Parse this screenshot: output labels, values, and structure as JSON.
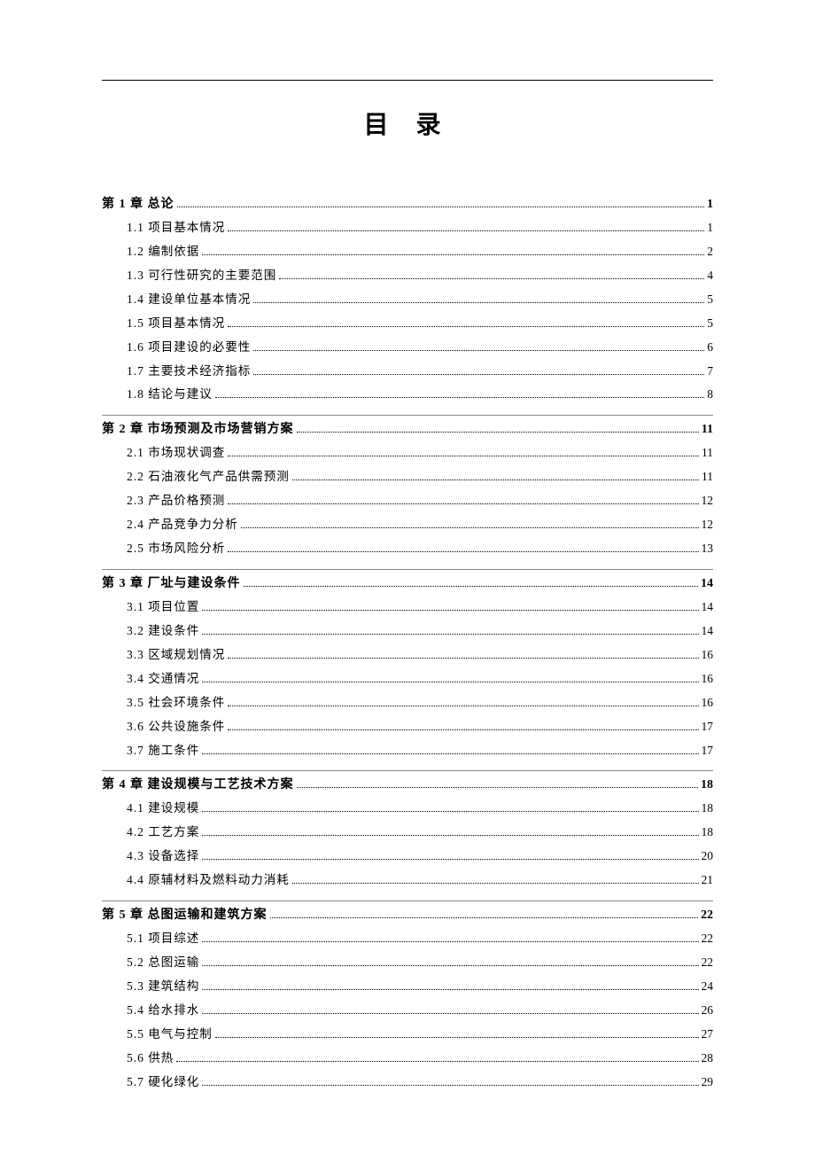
{
  "title": "目 录",
  "toc": [
    {
      "chapter": "第 1 章 总论",
      "page": "1",
      "sections": [
        {
          "num": "1.1",
          "label": "项目基本情况",
          "page": "1"
        },
        {
          "num": "1.2",
          "label": "编制依据",
          "page": "2"
        },
        {
          "num": "1.3",
          "label": "可行性研究的主要范围",
          "page": "4"
        },
        {
          "num": "1.4",
          "label": "建设单位基本情况",
          "page": "5"
        },
        {
          "num": "1.5",
          "label": "项目基本情况",
          "page": "5"
        },
        {
          "num": "1.6",
          "label": "项目建设的必要性",
          "page": "6"
        },
        {
          "num": "1.7",
          "label": "主要技术经济指标",
          "page": "7"
        },
        {
          "num": "1.8",
          "label": "结论与建议",
          "page": "8"
        }
      ]
    },
    {
      "chapter": "第 2 章  市场预测及市场营销方案",
      "page": "11",
      "sections": [
        {
          "num": "2.1",
          "label": "市场现状调查",
          "page": "11"
        },
        {
          "num": "2.2",
          "label": "石油液化气产品供需预测",
          "page": "11"
        },
        {
          "num": "2.3",
          "label": "产品价格预测",
          "page": "12"
        },
        {
          "num": "2.4",
          "label": "产品竞争力分析",
          "page": "12"
        },
        {
          "num": "2.5",
          "label": "市场风险分析",
          "page": "13"
        }
      ]
    },
    {
      "chapter": "第 3 章 厂址与建设条件",
      "page": "14",
      "sections": [
        {
          "num": "3.1",
          "label": "项目位置",
          "page": "14"
        },
        {
          "num": "3.2",
          "label": "建设条件",
          "page": "14"
        },
        {
          "num": "3.3",
          "label": "区域规划情况",
          "page": "16"
        },
        {
          "num": "3.4",
          "label": "交通情况",
          "page": "16"
        },
        {
          "num": "3.5",
          "label": "社会环境条件",
          "page": "16"
        },
        {
          "num": "3.6",
          "label": "公共设施条件",
          "page": "17"
        },
        {
          "num": "3.7",
          "label": "施工条件",
          "page": "17"
        }
      ]
    },
    {
      "chapter": "第 4 章 建设规模与工艺技术方案",
      "page": "18",
      "sections": [
        {
          "num": "4.1",
          "label": "建设规模",
          "page": "18"
        },
        {
          "num": "4.2",
          "label": "工艺方案",
          "page": "18"
        },
        {
          "num": "4.3",
          "label": "设备选择",
          "page": "20"
        },
        {
          "num": "4.4",
          "label": "原辅材料及燃料动力消耗",
          "page": "21"
        }
      ]
    },
    {
      "chapter": "第 5 章 总图运输和建筑方案",
      "page": "22",
      "sections": [
        {
          "num": "5.1",
          "label": "项目综述",
          "page": "22"
        },
        {
          "num": "5.2",
          "label": "总图运输",
          "page": "22"
        },
        {
          "num": "5.3",
          "label": "建筑结构",
          "page": "24"
        },
        {
          "num": "5.4",
          "label": "给水排水",
          "page": "26"
        },
        {
          "num": "5.5",
          "label": "电气与控制",
          "page": "27"
        },
        {
          "num": "5.6",
          "label": "供热",
          "page": "28"
        },
        {
          "num": "5.7",
          "label": "硬化绿化",
          "page": "29"
        }
      ]
    }
  ]
}
